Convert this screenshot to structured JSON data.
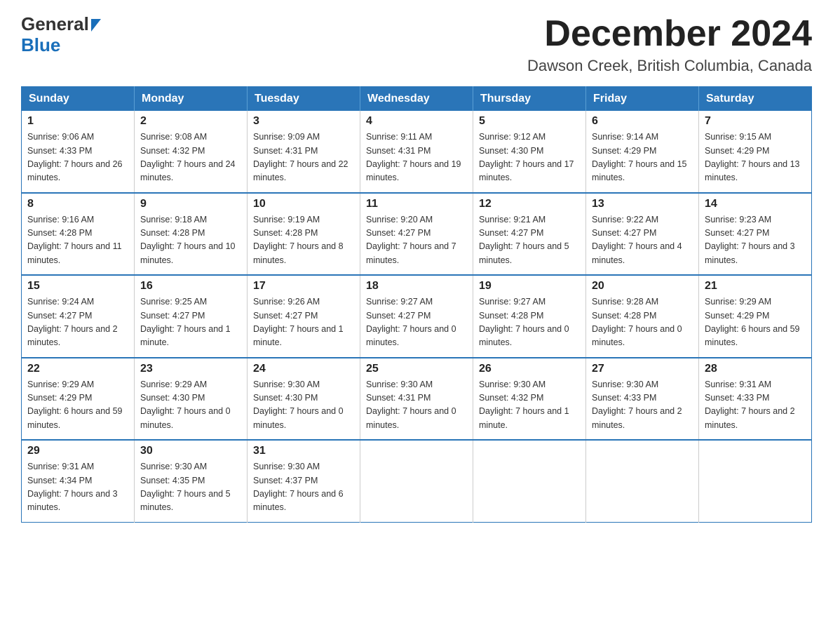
{
  "logo": {
    "general": "General",
    "blue": "Blue"
  },
  "title": "December 2024",
  "subtitle": "Dawson Creek, British Columbia, Canada",
  "days_of_week": [
    "Sunday",
    "Monday",
    "Tuesday",
    "Wednesday",
    "Thursday",
    "Friday",
    "Saturday"
  ],
  "weeks": [
    [
      {
        "day": "1",
        "sunrise": "9:06 AM",
        "sunset": "4:33 PM",
        "daylight": "7 hours and 26 minutes."
      },
      {
        "day": "2",
        "sunrise": "9:08 AM",
        "sunset": "4:32 PM",
        "daylight": "7 hours and 24 minutes."
      },
      {
        "day": "3",
        "sunrise": "9:09 AM",
        "sunset": "4:31 PM",
        "daylight": "7 hours and 22 minutes."
      },
      {
        "day": "4",
        "sunrise": "9:11 AM",
        "sunset": "4:31 PM",
        "daylight": "7 hours and 19 minutes."
      },
      {
        "day": "5",
        "sunrise": "9:12 AM",
        "sunset": "4:30 PM",
        "daylight": "7 hours and 17 minutes."
      },
      {
        "day": "6",
        "sunrise": "9:14 AM",
        "sunset": "4:29 PM",
        "daylight": "7 hours and 15 minutes."
      },
      {
        "day": "7",
        "sunrise": "9:15 AM",
        "sunset": "4:29 PM",
        "daylight": "7 hours and 13 minutes."
      }
    ],
    [
      {
        "day": "8",
        "sunrise": "9:16 AM",
        "sunset": "4:28 PM",
        "daylight": "7 hours and 11 minutes."
      },
      {
        "day": "9",
        "sunrise": "9:18 AM",
        "sunset": "4:28 PM",
        "daylight": "7 hours and 10 minutes."
      },
      {
        "day": "10",
        "sunrise": "9:19 AM",
        "sunset": "4:28 PM",
        "daylight": "7 hours and 8 minutes."
      },
      {
        "day": "11",
        "sunrise": "9:20 AM",
        "sunset": "4:27 PM",
        "daylight": "7 hours and 7 minutes."
      },
      {
        "day": "12",
        "sunrise": "9:21 AM",
        "sunset": "4:27 PM",
        "daylight": "7 hours and 5 minutes."
      },
      {
        "day": "13",
        "sunrise": "9:22 AM",
        "sunset": "4:27 PM",
        "daylight": "7 hours and 4 minutes."
      },
      {
        "day": "14",
        "sunrise": "9:23 AM",
        "sunset": "4:27 PM",
        "daylight": "7 hours and 3 minutes."
      }
    ],
    [
      {
        "day": "15",
        "sunrise": "9:24 AM",
        "sunset": "4:27 PM",
        "daylight": "7 hours and 2 minutes."
      },
      {
        "day": "16",
        "sunrise": "9:25 AM",
        "sunset": "4:27 PM",
        "daylight": "7 hours and 1 minute."
      },
      {
        "day": "17",
        "sunrise": "9:26 AM",
        "sunset": "4:27 PM",
        "daylight": "7 hours and 1 minute."
      },
      {
        "day": "18",
        "sunrise": "9:27 AM",
        "sunset": "4:27 PM",
        "daylight": "7 hours and 0 minutes."
      },
      {
        "day": "19",
        "sunrise": "9:27 AM",
        "sunset": "4:28 PM",
        "daylight": "7 hours and 0 minutes."
      },
      {
        "day": "20",
        "sunrise": "9:28 AM",
        "sunset": "4:28 PM",
        "daylight": "7 hours and 0 minutes."
      },
      {
        "day": "21",
        "sunrise": "9:29 AM",
        "sunset": "4:29 PM",
        "daylight": "6 hours and 59 minutes."
      }
    ],
    [
      {
        "day": "22",
        "sunrise": "9:29 AM",
        "sunset": "4:29 PM",
        "daylight": "6 hours and 59 minutes."
      },
      {
        "day": "23",
        "sunrise": "9:29 AM",
        "sunset": "4:30 PM",
        "daylight": "7 hours and 0 minutes."
      },
      {
        "day": "24",
        "sunrise": "9:30 AM",
        "sunset": "4:30 PM",
        "daylight": "7 hours and 0 minutes."
      },
      {
        "day": "25",
        "sunrise": "9:30 AM",
        "sunset": "4:31 PM",
        "daylight": "7 hours and 0 minutes."
      },
      {
        "day": "26",
        "sunrise": "9:30 AM",
        "sunset": "4:32 PM",
        "daylight": "7 hours and 1 minute."
      },
      {
        "day": "27",
        "sunrise": "9:30 AM",
        "sunset": "4:33 PM",
        "daylight": "7 hours and 2 minutes."
      },
      {
        "day": "28",
        "sunrise": "9:31 AM",
        "sunset": "4:33 PM",
        "daylight": "7 hours and 2 minutes."
      }
    ],
    [
      {
        "day": "29",
        "sunrise": "9:31 AM",
        "sunset": "4:34 PM",
        "daylight": "7 hours and 3 minutes."
      },
      {
        "day": "30",
        "sunrise": "9:30 AM",
        "sunset": "4:35 PM",
        "daylight": "7 hours and 5 minutes."
      },
      {
        "day": "31",
        "sunrise": "9:30 AM",
        "sunset": "4:37 PM",
        "daylight": "7 hours and 6 minutes."
      },
      null,
      null,
      null,
      null
    ]
  ],
  "labels": {
    "sunrise": "Sunrise:",
    "sunset": "Sunset:",
    "daylight": "Daylight:"
  }
}
